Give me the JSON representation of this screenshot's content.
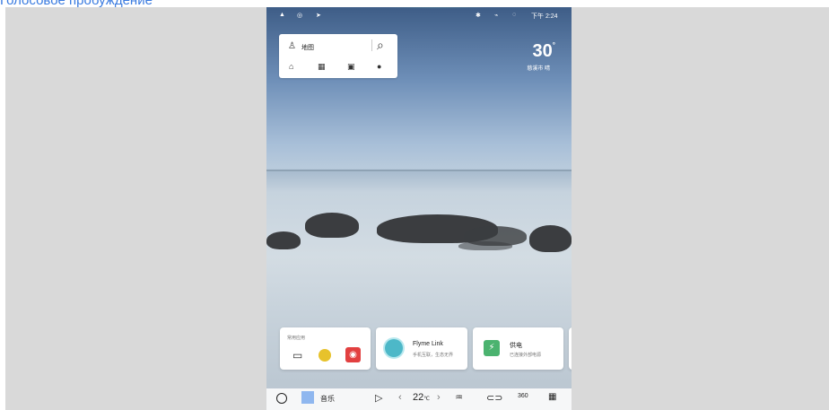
{
  "top_link": "Голосовое пробуждение",
  "status": {
    "left_icons": [
      "person-icon",
      "record-icon",
      "navigation-arrow-icon"
    ],
    "right_icons": [
      "bluetooth-icon",
      "signal-icon",
      "location-icon"
    ],
    "time": "下午 2:24"
  },
  "search": {
    "label": "地图",
    "icons": [
      "home-icon",
      "office-icon",
      "favorite-folder-icon",
      "settings-icon"
    ]
  },
  "weather": {
    "temp": "30",
    "unit": "°",
    "city": "慈溪市 晴"
  },
  "cards": [
    {
      "title": "常用应用",
      "apps": [
        "car-icon",
        "lemon-app-icon",
        "music-app-icon"
      ]
    },
    {
      "title": "Flyme Link",
      "subtitle": "手机互联，生态无界"
    },
    {
      "title": "供电",
      "subtitle": "已连接外部电源"
    }
  ],
  "dock": {
    "music_label": "音乐",
    "temperature": "22",
    "temp_unit": "℃",
    "auto_360": "360"
  },
  "colors": {
    "link": "#3a7be0",
    "accent_green": "#4bb36f",
    "music_red": "#e24040"
  }
}
